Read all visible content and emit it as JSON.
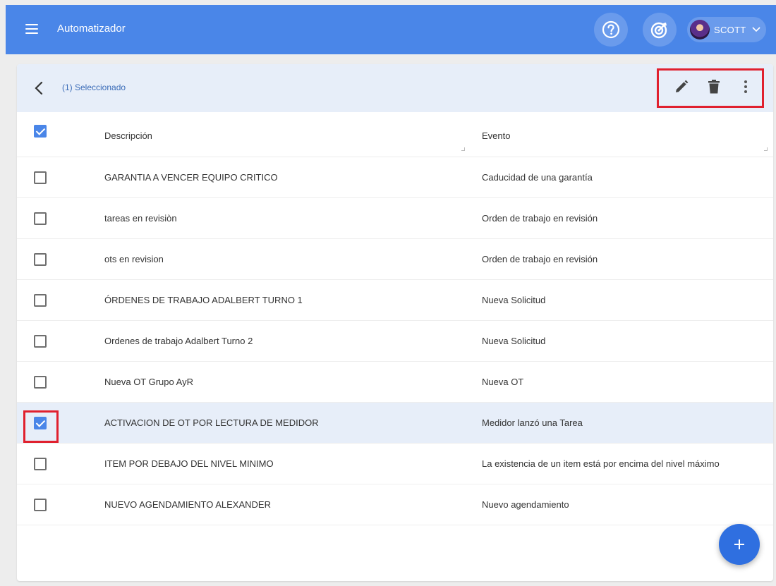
{
  "app": {
    "title": "Automatizador"
  },
  "header": {
    "user_name": "SCOTT",
    "help_icon": "help-circle-icon",
    "goal_icon": "target-icon",
    "menu_icon": "menu-icon"
  },
  "selection": {
    "text": "(1) Seleccionado"
  },
  "columns": {
    "description": "Descripción",
    "event": "Evento"
  },
  "rows": [
    {
      "description": "GARANTIA A VENCER EQUIPO CRITICO",
      "event": "Caducidad de una garantía",
      "checked": false
    },
    {
      "description": "tareas en revisiòn",
      "event": "Orden de trabajo en revisión",
      "checked": false
    },
    {
      "description": "ots en revision",
      "event": "Orden de trabajo en revisión",
      "checked": false
    },
    {
      "description": "ÓRDENES DE TRABAJO ADALBERT TURNO 1",
      "event": "Nueva Solicitud",
      "checked": false
    },
    {
      "description": "Ordenes de trabajo Adalbert Turno 2",
      "event": "Nueva Solicitud",
      "checked": false
    },
    {
      "description": "Nueva OT Grupo AyR",
      "event": "Nueva OT",
      "checked": false
    },
    {
      "description": "ACTIVACION DE OT POR LECTURA DE MEDIDOR",
      "event": "Medidor lanzó una Tarea",
      "checked": true
    },
    {
      "description": "ITEM POR DEBAJO DEL NIVEL MINIMO",
      "event": "La existencia de un item está por encima del nivel máximo",
      "checked": false
    },
    {
      "description": "NUEVO AGENDAMIENTO ALEXANDER",
      "event": "Nuevo agendamiento",
      "checked": false
    }
  ],
  "colors": {
    "appbar": "#4a86e8",
    "selection_bg": "#e7eef9",
    "highlight_box": "#e0202e",
    "fab": "#2f6fe0"
  }
}
